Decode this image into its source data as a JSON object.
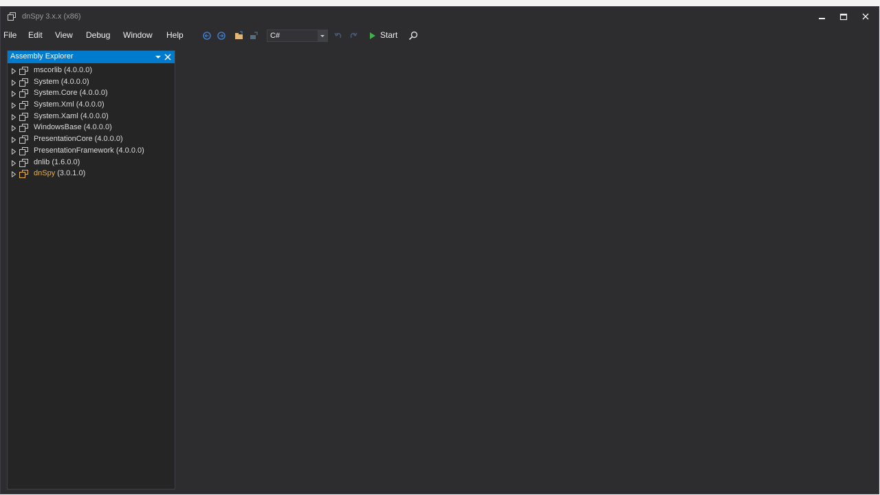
{
  "window": {
    "title": "dnSpy 3.x.x (x86)",
    "controls": {
      "minimize": "minimize",
      "maximize": "maximize",
      "close": "close"
    }
  },
  "menu": {
    "items": [
      "File",
      "Edit",
      "View",
      "Debug",
      "Window",
      "Help"
    ]
  },
  "toolbar": {
    "language": "C#",
    "start_label": "Start",
    "icons": [
      "navigate-back-icon",
      "navigate-forward-icon",
      "open-folder-icon",
      "open-list-icon",
      "undo-icon",
      "redo-icon",
      "start-debug-icon",
      "search-icon"
    ]
  },
  "assembly_explorer": {
    "title": "Assembly Explorer",
    "items": [
      {
        "name": "mscorlib",
        "version": "(4.0.0.0)"
      },
      {
        "name": "System",
        "version": "(4.0.0.0)"
      },
      {
        "name": "System.Core",
        "version": "(4.0.0.0)"
      },
      {
        "name": "System.Xml",
        "version": "(4.0.0.0)"
      },
      {
        "name": "System.Xaml",
        "version": "(4.0.0.0)"
      },
      {
        "name": "WindowsBase",
        "version": "(4.0.0.0)"
      },
      {
        "name": "PresentationCore",
        "version": "(4.0.0.0)"
      },
      {
        "name": "PresentationFramework",
        "version": "(4.0.0.0)"
      },
      {
        "name": "dnlib",
        "version": "(1.6.0.0)"
      },
      {
        "name": "dnSpy",
        "version": "(3.0.1.0)",
        "highlighted": true
      }
    ]
  },
  "colors": {
    "accent": "#007acc",
    "highlight_item": "#e8b04a",
    "background": "#2d2d30"
  }
}
